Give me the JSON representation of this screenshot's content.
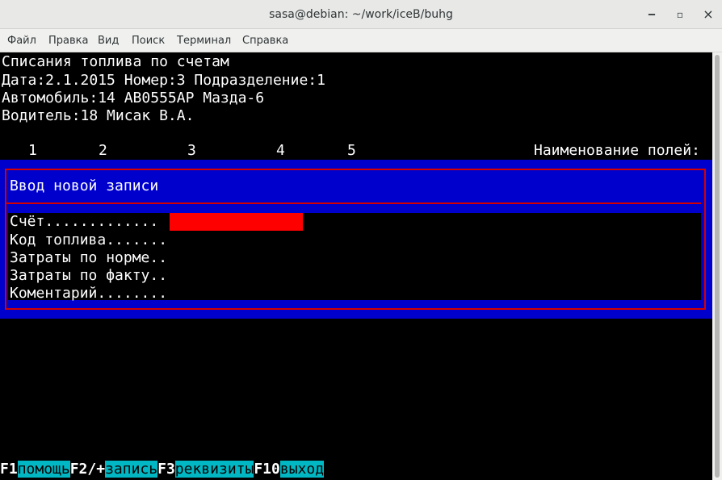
{
  "window": {
    "title": "sasa@debian: ~/work/iceB/buhg",
    "minimize_glyph": "‒",
    "maximize_glyph": "▫",
    "close_glyph": "×"
  },
  "menu": {
    "items": [
      {
        "label": "Файл"
      },
      {
        "label": "Правка"
      },
      {
        "label": "Вид"
      },
      {
        "label": "Поиск"
      },
      {
        "label": "Терминал"
      },
      {
        "label": "Справка"
      }
    ]
  },
  "header": {
    "title": "Списания топлива по счетам",
    "date_line": "Дата:2.1.2015 Номер:3 Подразделение:1",
    "car_line": "Автомобиль:14 AB0555AP Мазда-6",
    "driver_line": "Водитель:18 Мисак В.А."
  },
  "columns": {
    "numbers": [
      "1",
      "2",
      "3",
      "4",
      "5"
    ],
    "fields_caption": "Наименование полей:"
  },
  "form": {
    "title": "Ввод новой записи",
    "fields": [
      {
        "label": "Счёт.............",
        "value": ""
      },
      {
        "label": "Код топлива.......",
        "value": ""
      },
      {
        "label": "Затраты по норме..",
        "value": ""
      },
      {
        "label": "Затраты по факту..",
        "value": ""
      },
      {
        "label": "Коментарий........",
        "value": ""
      }
    ]
  },
  "function_keys": [
    {
      "key": "F1",
      "label": "помощь"
    },
    {
      "key": "F2/+",
      "label": "запись"
    },
    {
      "key": "F3",
      "label": "реквизиты"
    },
    {
      "key": "F10",
      "label": "выход"
    }
  ],
  "colors": {
    "form_background": "#0000cd",
    "form_border": "#d40000",
    "active_field": "#ff0000",
    "fkey_label_background": "#00b7c3"
  }
}
